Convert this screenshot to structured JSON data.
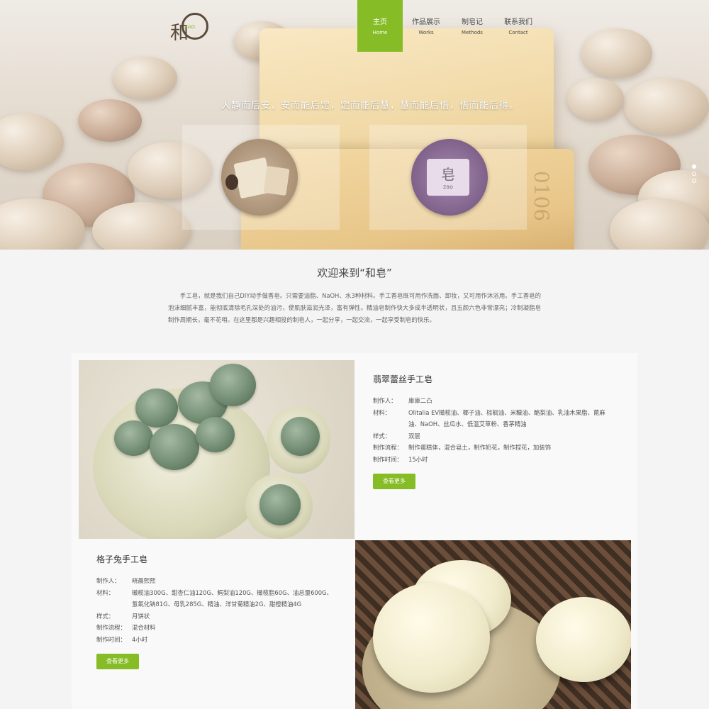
{
  "brand": {
    "logo_mark": "和",
    "logo_sub": "ZAO"
  },
  "nav": {
    "items": [
      {
        "cn": "主页",
        "en": "Home",
        "active": true
      },
      {
        "cn": "作品展示",
        "en": "Works",
        "active": false
      },
      {
        "cn": "制皂记",
        "en": "Methods",
        "active": false
      },
      {
        "cn": "联系我们",
        "en": "Contact",
        "active": false
      }
    ]
  },
  "hero": {
    "slogan": "人静而后安，安而能后定，定而能后慧，慧而能后悟，悟而能后得。",
    "soap_emboss": "0106",
    "circle2_label_big": "皂",
    "circle2_label_small": "zao",
    "slides_count": 3,
    "active_slide": 1
  },
  "welcome": {
    "title": "欢迎来到“和皂”",
    "text": "手工皂，就是我们自己DIY动手做香皂。只需要油脂、NaOH、水3种材料。手工香皂既可用作洗面、卸妆，又可用作沐浴用。手工香皂的泡沫细腻丰富，能彻底清除毛孔深处的油污，使肌肤滋润光泽，富有弹性。精油皂制作快大多成半透明状，且五颜六色非常漂亮；冷制凝脂皂制作周期长，毫不花哨。在这里都是兴趣相投的制皂人，一起分享，一起交流，一起享受制皂的快乐。"
  },
  "products": [
    {
      "title": "翡翠蕾丝手工皂",
      "rows": [
        {
          "key": "制作人：",
          "value": "庫庫二凸"
        },
        {
          "key": "材料：",
          "value": "Olitalia EV橄榄油、椰子油、棕榈油、米糠油、酪梨油、乳油木果脂、蓖麻油、NaOH、丝瓜水、低温艾草粉、香茅精油"
        },
        {
          "key": "样式：",
          "value": "双层"
        },
        {
          "key": "制作流程：",
          "value": "制作蛋糕体，混合皂土，制作奶花，制作捏花，加装饰"
        },
        {
          "key": "制作时间：",
          "value": "15小时"
        }
      ],
      "button": "查看更多"
    },
    {
      "title": "格子兔手工皂",
      "rows": [
        {
          "key": "制作人：",
          "value": "晓晨熙熙"
        },
        {
          "key": "材料：",
          "value": "橄榄油300G、甜杏仁油120G、鳄梨油120G、橄榄脂60G、油总量600G、氢氧化钠81G、母乳285G、精油、洋甘菊精油2G、甜橙精油4G"
        },
        {
          "key": "样式：",
          "value": "月饼状"
        },
        {
          "key": "制作流程：",
          "value": "混合材料"
        },
        {
          "key": "制作时间：",
          "value": "4小时"
        }
      ],
      "button": "查看更多"
    }
  ],
  "colors": {
    "accent": "#86bc25",
    "text": "#555555"
  }
}
